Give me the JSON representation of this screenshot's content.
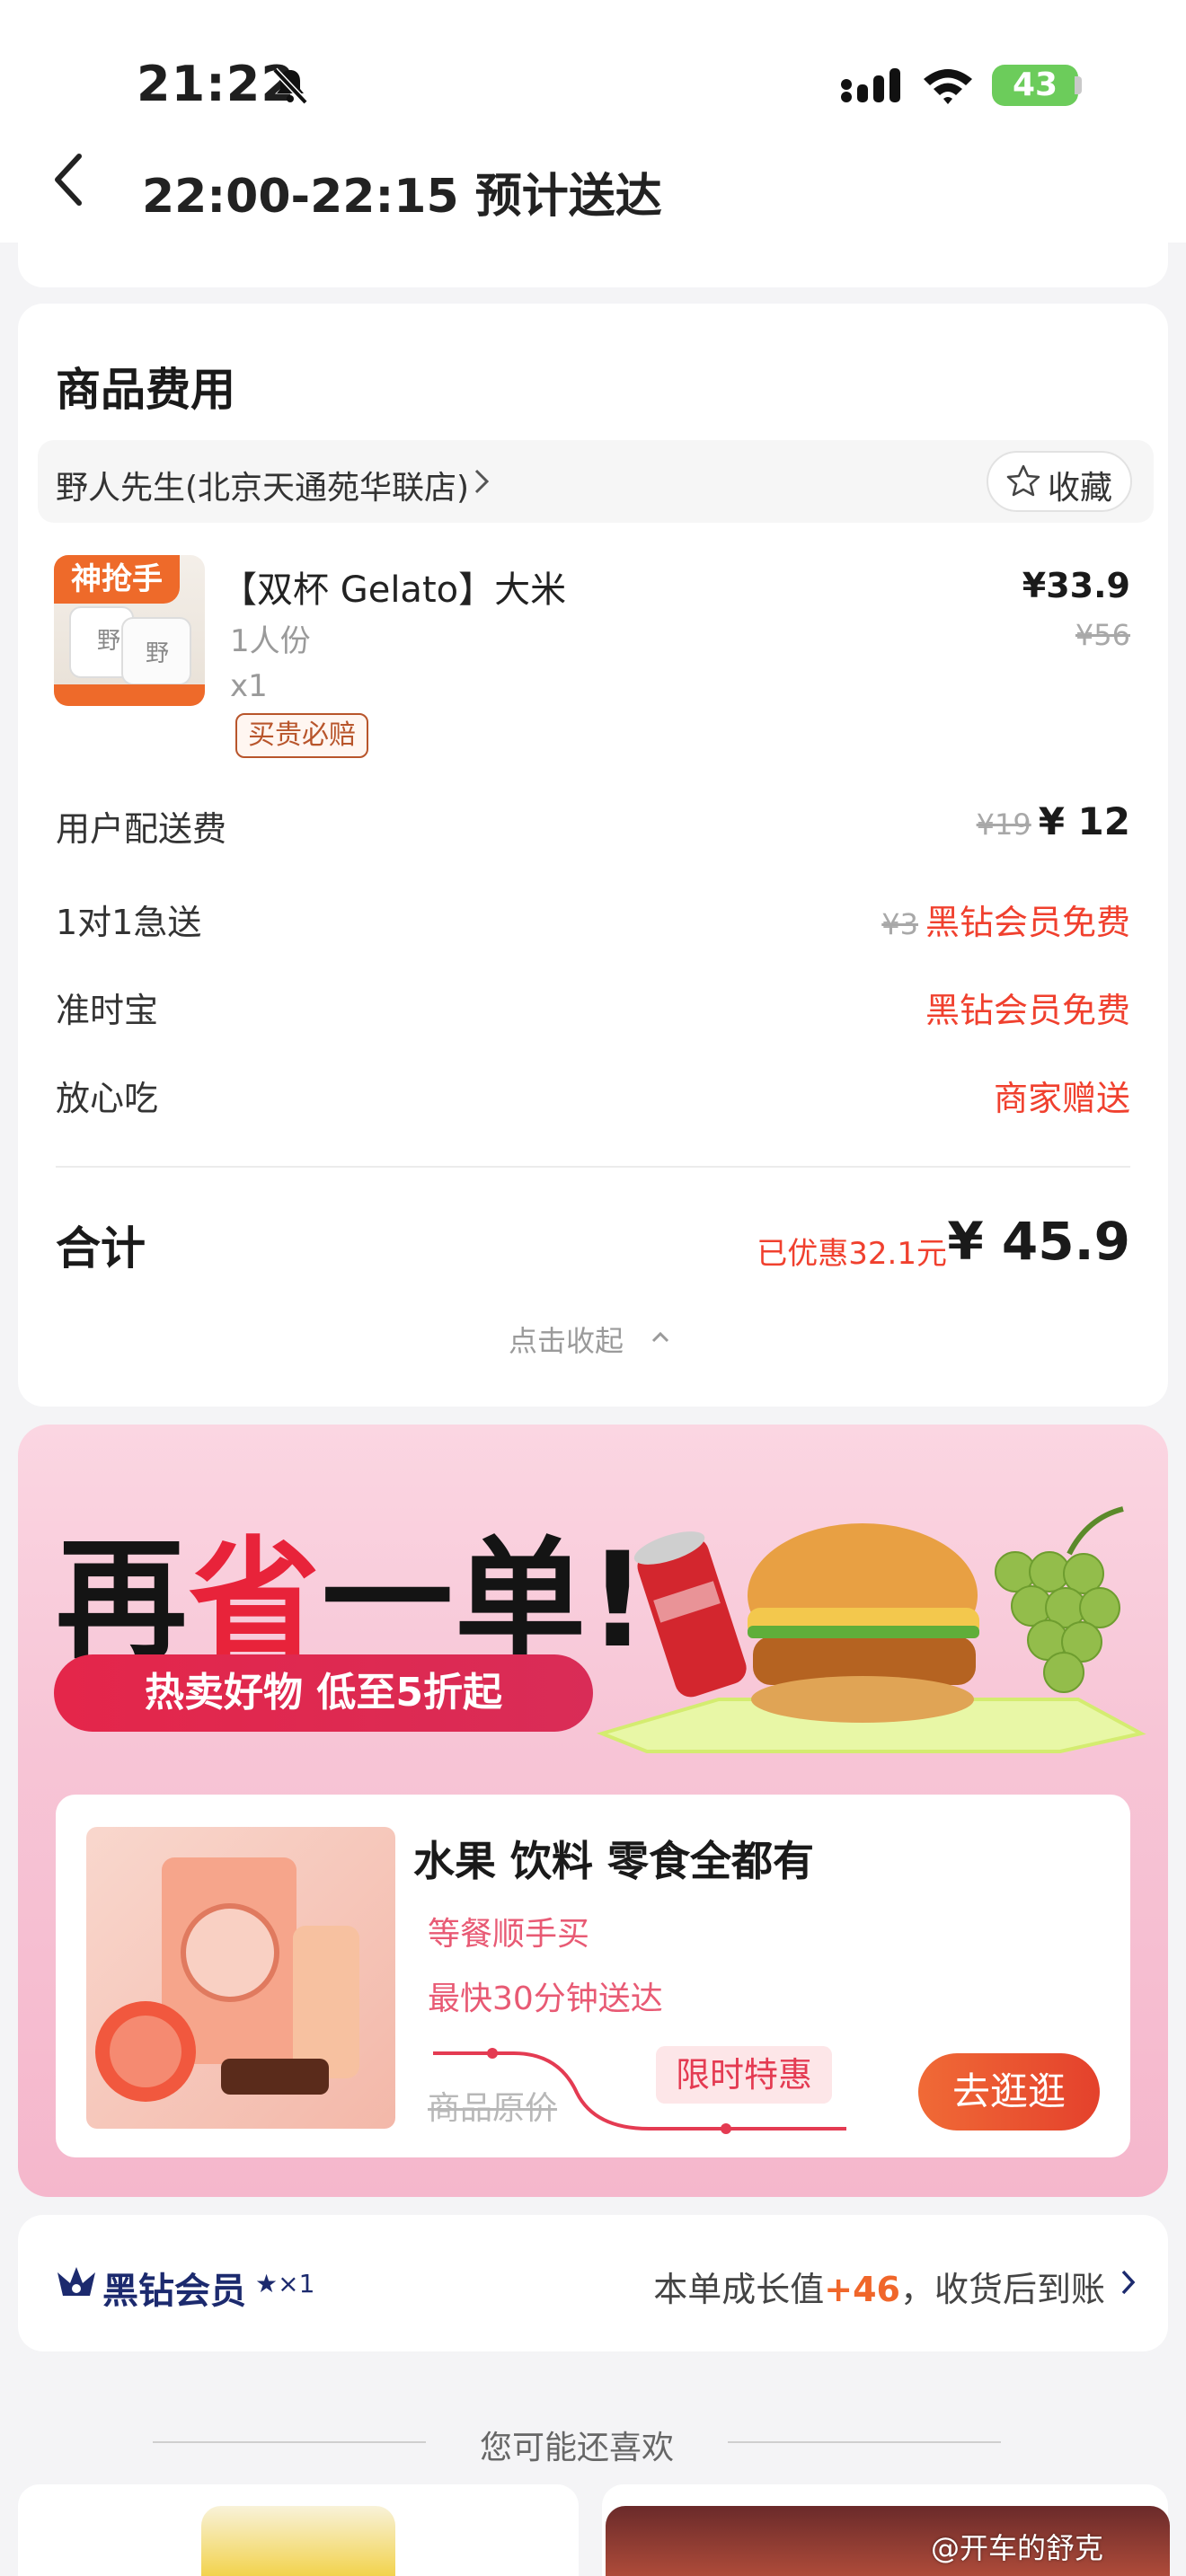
{
  "status_bar": {
    "time": "21:22",
    "battery": "43"
  },
  "nav": {
    "title": "22:00-22:15 预计送达"
  },
  "fee_card": {
    "title": "商品费用",
    "store_name": "野人先生(北京天通苑华联店)",
    "favorite_label": "收藏",
    "product": {
      "badge": "神抢手",
      "name": "【双杯 Gelato】大米",
      "spec": "1人份",
      "qty": "x1",
      "guarantee": "买贵必赔",
      "price": "¥33.9",
      "original_price": "¥56"
    },
    "fees": [
      {
        "label": "用户配送费",
        "original": "¥19",
        "value": "¥ 12"
      },
      {
        "label": "1对1急送",
        "original": "¥3",
        "value": "黑钻会员免费"
      },
      {
        "label": "准时宝",
        "value": "黑钻会员免费"
      },
      {
        "label": "放心吃",
        "value": "商家赠送"
      }
    ],
    "total_label": "合计",
    "discount_text": "已优惠32.1元",
    "total_price": "¥ 45.9",
    "collapse_label": "点击收起"
  },
  "promo": {
    "title_part1": "再",
    "title_part2": "省",
    "title_part3": "一单!",
    "pill": "热卖好物 低至5折起",
    "inner_title": "水果 饮料 零食全都有",
    "sub1": "等餐顺手买",
    "sub2": "最快30分钟送达",
    "original_price_label": "商品原价",
    "limited_label": "限时特惠",
    "go_button": "去逛逛"
  },
  "member": {
    "name": "黑钻会员",
    "star": "★×1",
    "info_prefix": "本单成长值",
    "info_value": "+46",
    "info_suffix": "，收货后到账"
  },
  "recommend": {
    "title": "您可能还喜欢"
  },
  "watermark": "@开车的舒克",
  "colors": {
    "accent_red": "#f0402e",
    "orange": "#f0662a",
    "member_navy": "#1c2a6e"
  }
}
